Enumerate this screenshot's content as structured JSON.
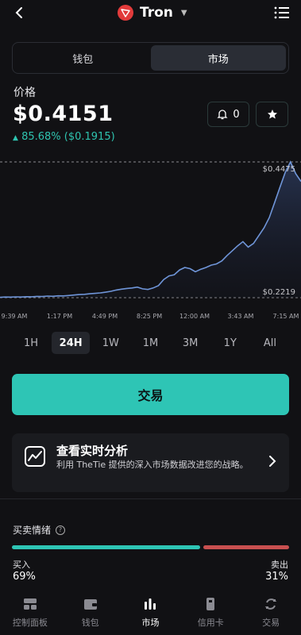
{
  "header": {
    "title": "Tron"
  },
  "segment": {
    "tabs": [
      "钱包",
      "市场"
    ],
    "active": 1
  },
  "price": {
    "label": "价格",
    "value": "$0.4151",
    "change": "85.68% ($0.1915)",
    "alerts_count": "0"
  },
  "colors": {
    "accent": "#2ec5b5",
    "sell": "#c85050",
    "line": "#6f95d8",
    "background": "#111114"
  },
  "chart_data": {
    "type": "area",
    "x": [
      "9:39 AM",
      "1:17 PM",
      "4:49 PM",
      "8:25 PM",
      "12:00 AM",
      "3:43 AM",
      "7:15 AM"
    ],
    "ylim": [
      0.2219,
      0.4475
    ],
    "reference_lines": [
      "$0.4475",
      "$0.2219"
    ],
    "values": [
      0.2225,
      0.223,
      0.2228,
      0.2232,
      0.2229,
      0.2235,
      0.2233,
      0.224,
      0.2238,
      0.2245,
      0.2242,
      0.225,
      0.2248,
      0.2255,
      0.2262,
      0.227,
      0.2275,
      0.2283,
      0.229,
      0.2298,
      0.231,
      0.2325,
      0.2345,
      0.236,
      0.2372,
      0.238,
      0.2395,
      0.2365,
      0.2355,
      0.238,
      0.242,
      0.252,
      0.258,
      0.26,
      0.268,
      0.272,
      0.27,
      0.265,
      0.269,
      0.272,
      0.276,
      0.278,
      0.283,
      0.292,
      0.3,
      0.308,
      0.315,
      0.306,
      0.312,
      0.325,
      0.338,
      0.355,
      0.38,
      0.405,
      0.43,
      0.4475,
      0.428,
      0.4151
    ],
    "title": "",
    "xlabel": "",
    "ylabel": ""
  },
  "ranges": [
    "1H",
    "24H",
    "1W",
    "1M",
    "3M",
    "1Y",
    "All"
  ],
  "active_range": 1,
  "trade_button": "交易",
  "card": {
    "title": "查看实时分析",
    "desc": "利用 TheTie 提供的深入市场数据改进您的战略。"
  },
  "sentiment": {
    "title": "买卖情绪",
    "buy_label": "买入",
    "buy_value": "69%",
    "buy_fraction": 0.69,
    "sell_label": "卖出",
    "sell_value": "31%"
  },
  "tabbar": [
    {
      "label": "控制面板",
      "icon": "dashboard-icon"
    },
    {
      "label": "钱包",
      "icon": "wallet-icon"
    },
    {
      "label": "市场",
      "icon": "market-icon"
    },
    {
      "label": "信用卡",
      "icon": "card-icon"
    },
    {
      "label": "交易",
      "icon": "trade-icon"
    }
  ],
  "active_tab": 2
}
